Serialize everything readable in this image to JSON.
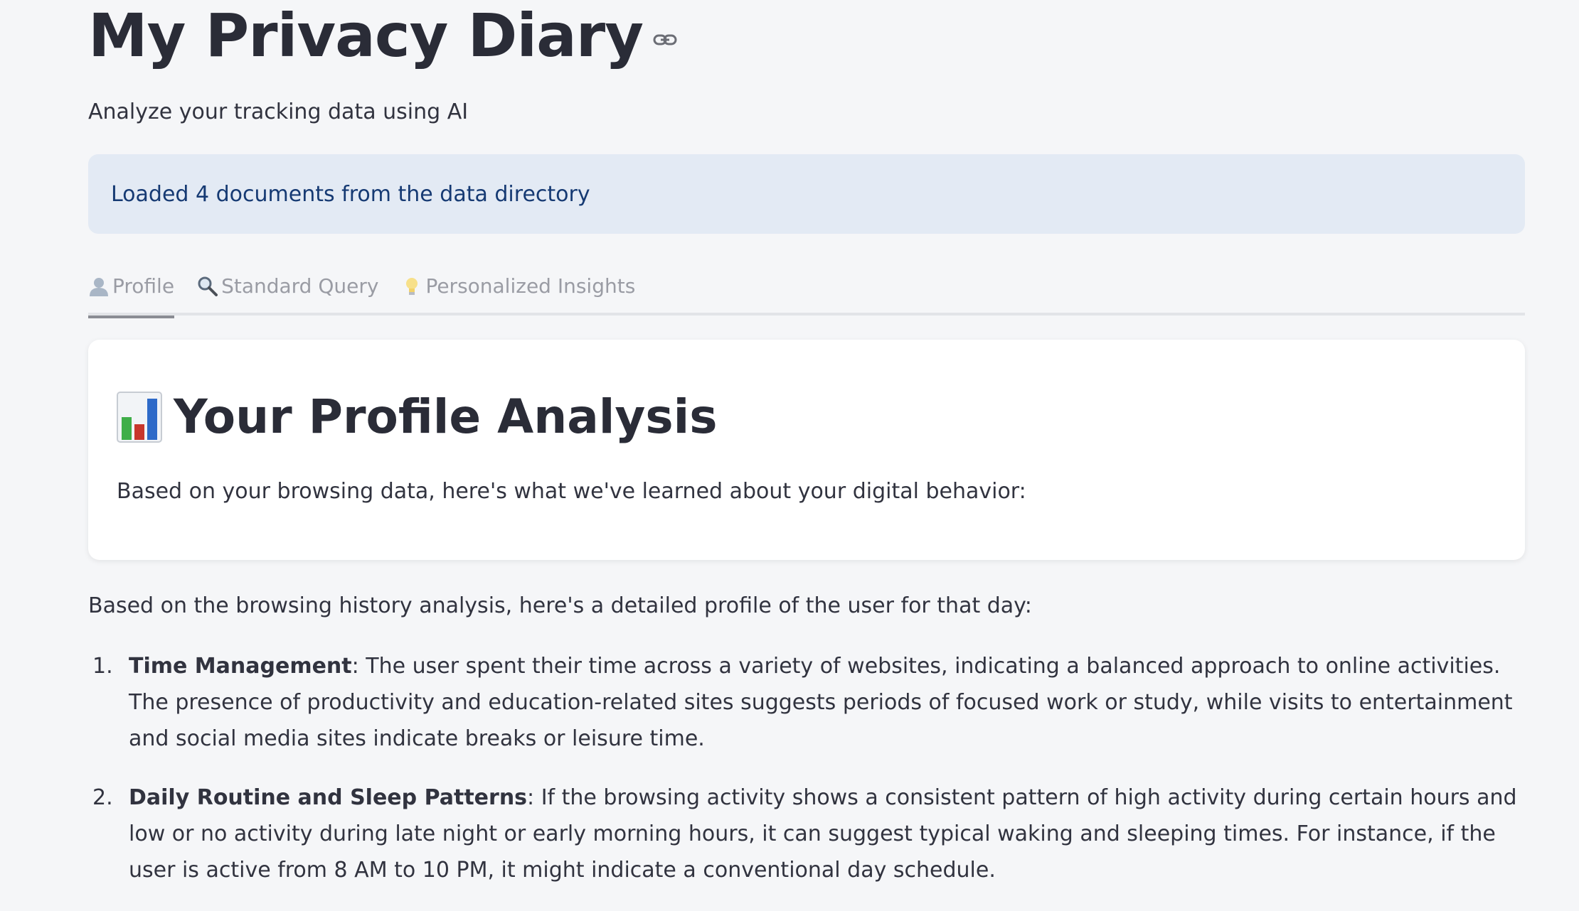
{
  "header": {
    "title": "My Privacy Diary",
    "subtitle": "Analyze your tracking data using AI"
  },
  "info": {
    "message": "Loaded 4 documents from the data directory"
  },
  "tabs": [
    {
      "label": "Profile",
      "icon": "person-icon",
      "active": true
    },
    {
      "label": "Standard Query",
      "icon": "magnifier-icon",
      "active": false
    },
    {
      "label": "Personalized Insights",
      "icon": "lightbulb-icon",
      "active": false
    }
  ],
  "card": {
    "icon": "bar-chart-icon",
    "title": "Your Profile Analysis",
    "description": "Based on your browsing data, here's what we've learned about your digital behavior:"
  },
  "analysis": {
    "intro": "Based on the browsing history analysis, here's a detailed profile of the user for that day:",
    "items": [
      {
        "number": "1.",
        "heading": "Time Management",
        "text": ": The user spent their time across a variety of websites, indicating a balanced approach to online activities. The presence of productivity and education-related sites suggests periods of focused work or study, while visits to entertainment and social media sites indicate breaks or leisure time."
      },
      {
        "number": "2.",
        "heading": "Daily Routine and Sleep Patterns",
        "text": ": If the browsing activity shows a consistent pattern of high activity during certain hours and low or no activity during late night or early morning hours, it can suggest typical waking and sleeping times. For instance, if the user is active from 8 AM to 10 PM, it might indicate a conventional day schedule."
      }
    ]
  },
  "colors": {
    "background": "#f5f6f8",
    "info_bg": "#e3eaf4",
    "info_text": "#163a73",
    "tab_inactive": "#9a9ca4"
  }
}
